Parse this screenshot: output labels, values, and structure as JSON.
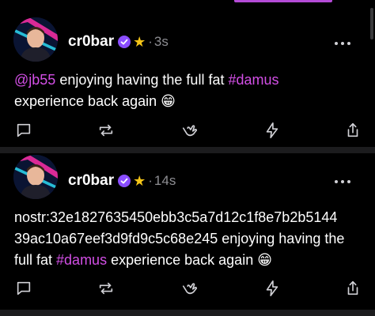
{
  "posts": [
    {
      "username": "cr0bar",
      "star": "★",
      "separator": "·",
      "time": "3s",
      "content": {
        "mention": "@jb55",
        "text_a": " enjoying having the full fat ",
        "hashtag": "#damus",
        "text_b": " experience back again ",
        "emoji": "😁"
      }
    },
    {
      "username": "cr0bar",
      "star": "★",
      "separator": "·",
      "time": "14s",
      "content": {
        "text_a": "nostr:32e1827635450ebb3c5a7d12c1f8e7b2b5144 39ac10a67eef3d9fd9c5c68e245 enjoying having the full fat ",
        "hashtag": "#damus",
        "text_b": " experience back again ",
        "emoji": "😁"
      }
    }
  ],
  "actions": [
    "reply-icon",
    "repost-icon",
    "like-icon",
    "zap-icon",
    "share-icon"
  ],
  "colors": {
    "background": "#000000",
    "accent": "#d34fe6",
    "muted": "#8e8e93",
    "separator": "#1c1c1e",
    "verified": "#8a4dff",
    "star": "#f5c518"
  }
}
